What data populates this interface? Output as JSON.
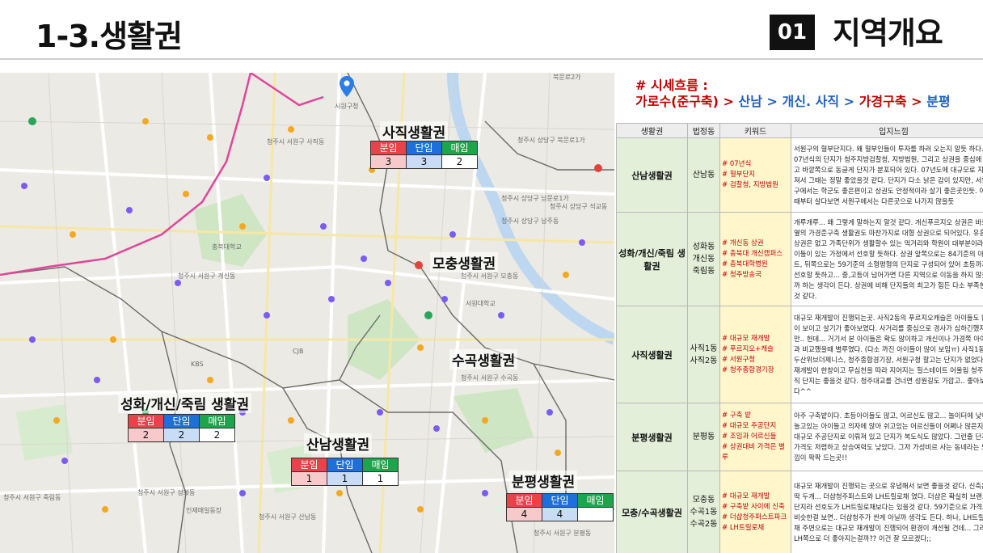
{
  "header": {
    "title": "1-3.생활권",
    "section_num": "01",
    "section_title": "지역개요"
  },
  "trend": {
    "line1": "# 시세흐름 :",
    "seg1": "가로수(준구축)",
    "seg2": "산남",
    "seg3": "개신.",
    "seg4": "사직",
    "seg5": "가경구축",
    "seg6": "분평",
    "arrow": ">"
  },
  "map": {
    "table_headers": [
      "분임",
      "단임",
      "매임"
    ],
    "regions": [
      {
        "name": "사직생활권",
        "values": [
          "3",
          "3",
          "2"
        ]
      },
      {
        "name": "모충생활권"
      },
      {
        "name": "수곡생활권"
      },
      {
        "name": "성화/개신/죽림 생활권",
        "values": [
          "2",
          "2",
          "2"
        ]
      },
      {
        "name": "산남생활권",
        "values": [
          "1",
          "1",
          "1"
        ]
      },
      {
        "name": "분평생활권",
        "values": [
          "4",
          "4",
          ""
        ]
      }
    ],
    "labels": [
      "북문로2가",
      "청주시 서원구 사직동",
      "시원구청",
      "청주시 서원구 사직동",
      "청주시 상당구 북문로1가",
      "청주시 상당구 남문로1가",
      "청주시 상당구 남주동",
      "청주시 상당구 남문로2가",
      "청주시 상당구 석교동",
      "청주시 서원구 모충동",
      "청주시 서원구 수곡동",
      "청주시 서원구 성화동",
      "청주시 서원구 분평동",
      "청주시 서원구 개신동",
      "청주시 서원구 죽림동",
      "청주시 서원구 산남동",
      "충북대학교",
      "서원대학교",
      "KBS",
      "CJB",
      "인제매일동장",
      "청주터미널",
      "한국교원대",
      "더샵청주센트럴",
      "다원리트",
      "청주시 서원구 모충동",
      "청주시 흥덕구 가경동"
    ]
  },
  "table": {
    "headers": [
      "생활권",
      "법정동",
      "키워드",
      "입지느낌"
    ],
    "rows": [
      {
        "area": "산남생활권",
        "dong": "산남동",
        "keywords": [
          "# 07년식",
          "# 혈부단지",
          "# 검찰청, 지방법원"
        ],
        "note": "서원구의 혈부단지다. 왜 혈부인들이 투자를 하러 오는지 알듯 하다. 07년식의 단지가 청주지방검찰청, 지방법원, 그리고 상권을 중심에 두고 바깥쪽으로 동글게 단지가 분포되어 있다. 07년도에 대규모로 지어져서 그때는 정말 좋았을것 같다. 단지가 다소 낡은 감이 있지만, 서원구에서는 학군도 좋은편이고 상권도 안정적이라 살기 좋은곳인듯. 어릴때부터 살다보면 서원구에서는 다른곳으로 나가지 않을듯"
      },
      {
        "area": "성화/개신/죽림 생활권",
        "dong": "성화동 개신동 죽림동",
        "keywords": [
          "# 개신동 상권",
          "# 충북대 개신캠퍼스",
          "# 충북대학병원",
          "# 청주방송국"
        ],
        "note": "개루개루... 왜 그렇게 말하는지 알것 같다. 개신푸르지오 상권은 바로 옆의 가경준구축 생활권도 마찬가지로 대형 상권으로 되어있다. 유흥 상권은 없고 가족단위가 생활할수 있는 먹거리와 학원이 대부분이라 아이들이 있는 가정에서 선호할 듯하다. 상권 앞쪽으로는 84기준의 아파트, 뒤쪽으로는 59기준의 소형평형의 단지로 구성되어 있어 초등까지 선호할 듯하고... 중,고등이 넘어가면 다른 지역으로 이동을 하지 않을까 하는 생각이 든다. 상권에 비해 단지들의 최고가 힘든 다소 부족한 것 같다."
      },
      {
        "area": "사직생활권",
        "dong": "사직1동 사직2동",
        "keywords": [
          "# 대규모 재개발",
          "# 푸르지오+캐슬",
          "# 서원구청",
          "# 청주종합경기장"
        ],
        "note": "대규모 재개발이 진행되는곳. 사직2동의 푸르지오캐슬은 아이들도 많이 보이고 살기가 좋아보였다. 사거리를 중심으로 경사가 심하긴했지만.. 헌데... 거기서 본 아이들은 확도 많이하고 개신이나 가경쪽 아이들과 비교했을때 별루였다. (다소 까진 아이들이 많이 보임ㅠ) 사직1동은 두산위브더제니스, 청주종합경기장, 서원구청 할고는 단지가 없었다. 재개발이 한창이고 무심천을 따라 지어지는 힐스테이트 어울림 청주사직 단지는 좋을것 같다. 청주대교를 건너면 성원길도 가깝고.. 좋아보였다^^"
      },
      {
        "area": "분평생활권",
        "dong": "분평동",
        "keywords": [
          "# 구축 밭",
          "# 대규모 주공단지",
          "# 조임과 어르신들",
          "# 상권대비 가격은 별루"
        ],
        "note": "아주 구축밭이다. 초등아이들도 많고, 어르신도 많고... 놀이터에 낮에 놀고있는 아이들고 의자에 앉아 쉬고있는 어르신들이 어쩌나 많은지... 대규모 주공단지로 이뤄져 있고 단지가 복도식도 많았다. 그런줄 단지 가격도 저렴하고 상승여력도 낮았다. 그저 가성비르 사는 동네라는 느낌이 팍팍 드는곳!!"
      },
      {
        "area": "모충/수곡생활권",
        "dong": "모충동 수곡1동 수곡2동",
        "keywords": [
          "# 대규모 재개발",
          "# 구축밭 사이에 신축",
          "# 더샵청주퍼스트파크",
          "# LH트릴로채"
        ],
        "note": "대규모 재개발이 진행되는 곳으로 유념해서 보면 좋을것 같다. 신축은 딱 두개... 더샵청주퍼스트와 LH트릴로채 였다. 더샵은 확실히 브랜드단지라 선호도가 LH트릴로채보다는 있을것 같다. 59기준으로 가격도 비슷한걸 보면.. 더샵청주가 싼게 아닐까 생각도 든다. 하나, LH트릴로채 주변으로는 대규모 재개발이 진행되어 환경이 개선될 건데... 그러면 LH쪽으로 더 좋아지는걸까?? 이건 잘 모르겠다;;"
      }
    ]
  }
}
